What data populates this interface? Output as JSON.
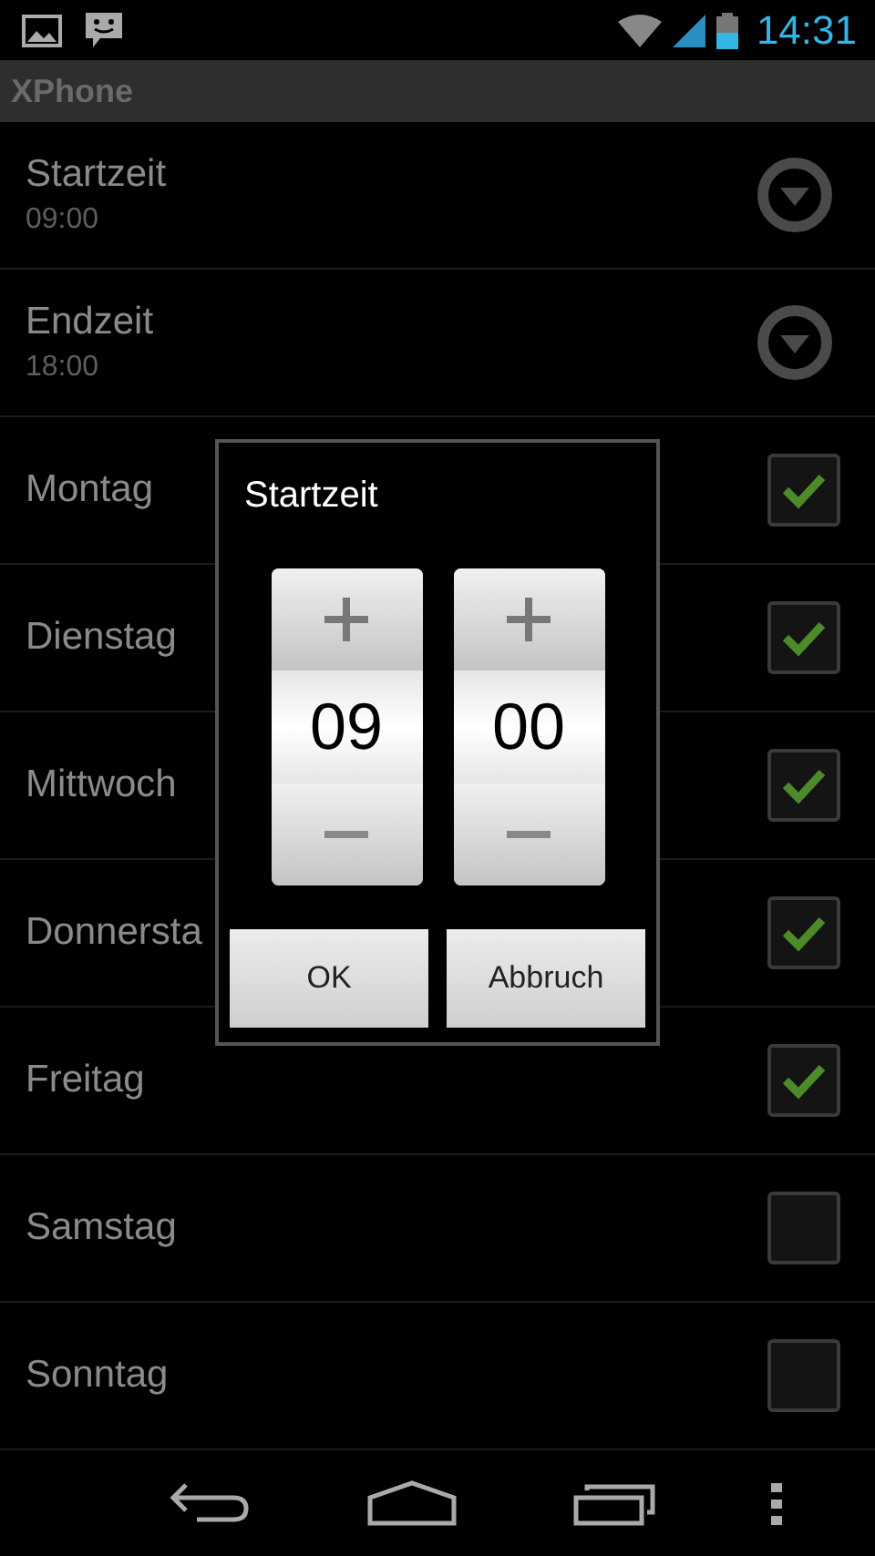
{
  "status_bar": {
    "time": "14:31"
  },
  "app_bar": {
    "title": "XPhone"
  },
  "settings": [
    {
      "kind": "time",
      "label": "Startzeit",
      "value": "09:00"
    },
    {
      "kind": "time",
      "label": "Endzeit",
      "value": "18:00"
    },
    {
      "kind": "day",
      "label": "Montag",
      "checked": true
    },
    {
      "kind": "day",
      "label": "Dienstag",
      "checked": true
    },
    {
      "kind": "day",
      "label": "Mittwoch",
      "checked": true
    },
    {
      "kind": "day",
      "label": "Donnersta",
      "checked": true
    },
    {
      "kind": "day",
      "label": "Freitag",
      "checked": true
    },
    {
      "kind": "day",
      "label": "Samstag",
      "checked": false
    },
    {
      "kind": "day",
      "label": "Sonntag",
      "checked": false
    }
  ],
  "dialog": {
    "title": "Startzeit",
    "pickers": [
      {
        "value": "09"
      },
      {
        "value": "00"
      }
    ],
    "buttons": [
      "OK",
      "Abbruch"
    ]
  }
}
